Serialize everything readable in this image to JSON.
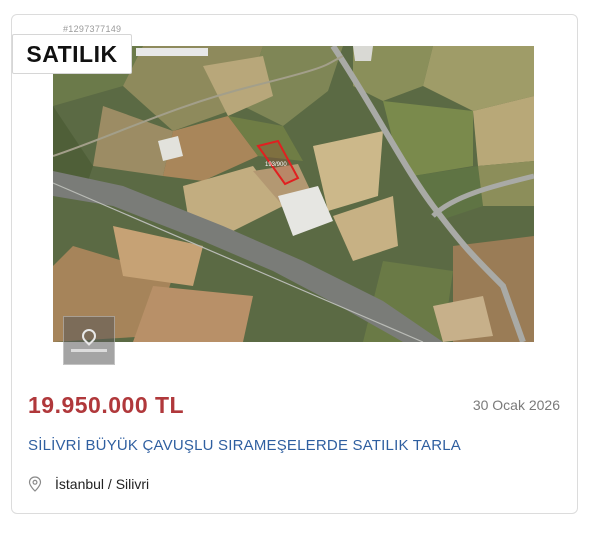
{
  "listing": {
    "id": "#1297377149",
    "status_label": "SATILIK",
    "price": "19.950.000 TL",
    "date": "30 Ocak 2026",
    "title": "SİLİVRİ BÜYÜK ÇAVUŞLU SIRAMEŞELERDE SATILIK TARLA",
    "location": "İstanbul / Silivri",
    "map_parcel_label": "193/900"
  },
  "icons": {
    "location": "map-pin-icon"
  },
  "colors": {
    "price": "#b0383b",
    "title": "#2f5fa0",
    "parcel_outline": "#e02020"
  }
}
